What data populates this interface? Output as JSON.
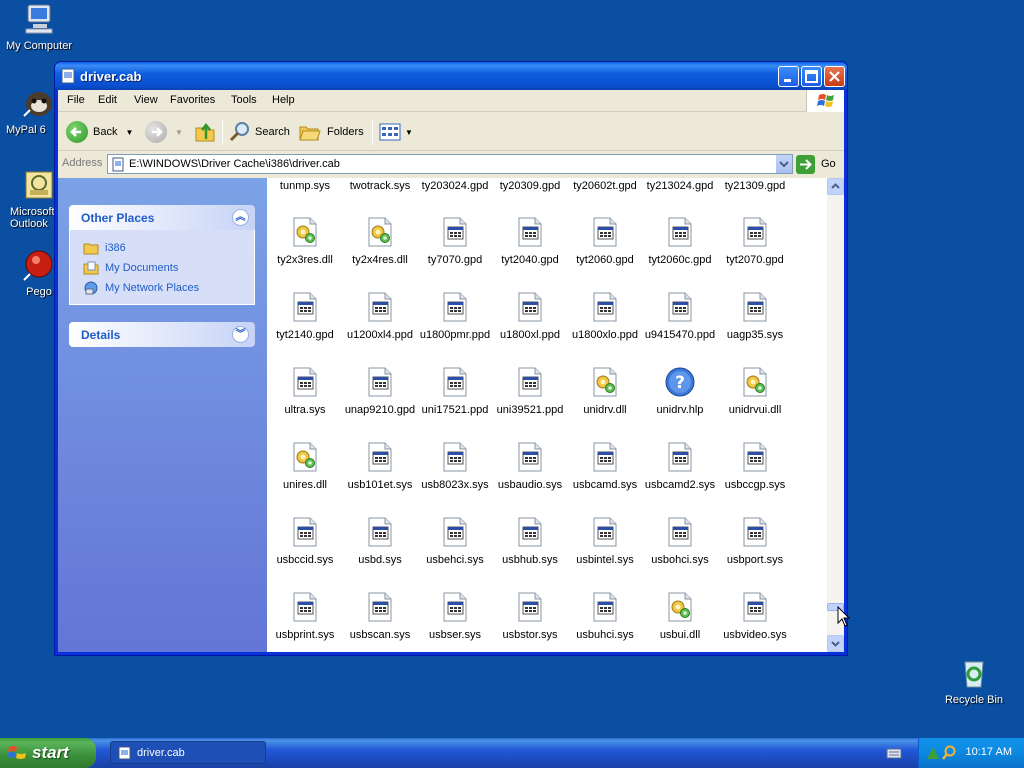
{
  "desktop": {
    "icons": [
      {
        "label": "My Computer",
        "icon": "my-computer-icon"
      },
      {
        "label": "MyPal 6",
        "icon": "mypal-icon"
      },
      {
        "label": "Microsoft Outlook",
        "icon": "outlook-icon"
      },
      {
        "label": "Pego",
        "icon": "pego-icon"
      },
      {
        "label": "Recycle Bin",
        "icon": "recycle-bin-icon"
      }
    ]
  },
  "window": {
    "title": "driver.cab",
    "menu": [
      "File",
      "Edit",
      "View",
      "Favorites",
      "Tools",
      "Help"
    ],
    "toolbar": {
      "back": "Back",
      "search": "Search",
      "folders": "Folders"
    },
    "address": {
      "label": "Address",
      "value": "E:\\WINDOWS\\Driver Cache\\i386\\driver.cab",
      "go": "Go"
    },
    "left_pane": {
      "other_places": {
        "title": "Other Places",
        "items": [
          {
            "label": "i386",
            "icon": "folder-icon"
          },
          {
            "label": "My Documents",
            "icon": "my-documents-icon"
          },
          {
            "label": "My Network Places",
            "icon": "network-places-icon"
          }
        ]
      },
      "details": {
        "title": "Details"
      }
    },
    "files": [
      {
        "name": "tunmp.sys",
        "type": "sys"
      },
      {
        "name": "twotrack.sys",
        "type": "sys"
      },
      {
        "name": "ty203024.gpd",
        "type": "gpd"
      },
      {
        "name": "ty20309.gpd",
        "type": "gpd"
      },
      {
        "name": "ty20602t.gpd",
        "type": "gpd"
      },
      {
        "name": "ty213024.gpd",
        "type": "gpd"
      },
      {
        "name": "ty21309.gpd",
        "type": "gpd"
      },
      {
        "name": "ty2x3res.dll",
        "type": "dll"
      },
      {
        "name": "ty2x4res.dll",
        "type": "dll"
      },
      {
        "name": "ty7070.gpd",
        "type": "gpd"
      },
      {
        "name": "tyt2040.gpd",
        "type": "gpd"
      },
      {
        "name": "tyt2060.gpd",
        "type": "gpd"
      },
      {
        "name": "tyt2060c.gpd",
        "type": "gpd"
      },
      {
        "name": "tyt2070.gpd",
        "type": "gpd"
      },
      {
        "name": "tyt2140.gpd",
        "type": "gpd"
      },
      {
        "name": "u1200xl4.ppd",
        "type": "ppd"
      },
      {
        "name": "u1800pmr.ppd",
        "type": "ppd"
      },
      {
        "name": "u1800xl.ppd",
        "type": "ppd"
      },
      {
        "name": "u1800xlo.ppd",
        "type": "ppd"
      },
      {
        "name": "u9415470.ppd",
        "type": "ppd"
      },
      {
        "name": "uagp35.sys",
        "type": "sys"
      },
      {
        "name": "ultra.sys",
        "type": "sys"
      },
      {
        "name": "unap9210.gpd",
        "type": "gpd"
      },
      {
        "name": "uni17521.ppd",
        "type": "ppd"
      },
      {
        "name": "uni39521.ppd",
        "type": "ppd"
      },
      {
        "name": "unidrv.dll",
        "type": "dll"
      },
      {
        "name": "unidrv.hlp",
        "type": "hlp"
      },
      {
        "name": "unidrvui.dll",
        "type": "dll"
      },
      {
        "name": "unires.dll",
        "type": "dll"
      },
      {
        "name": "usb101et.sys",
        "type": "sys"
      },
      {
        "name": "usb8023x.sys",
        "type": "sys"
      },
      {
        "name": "usbaudio.sys",
        "type": "sys"
      },
      {
        "name": "usbcamd.sys",
        "type": "sys"
      },
      {
        "name": "usbcamd2.sys",
        "type": "sys"
      },
      {
        "name": "usbccgp.sys",
        "type": "sys"
      },
      {
        "name": "usbccid.sys",
        "type": "sys"
      },
      {
        "name": "usbd.sys",
        "type": "sys"
      },
      {
        "name": "usbehci.sys",
        "type": "sys"
      },
      {
        "name": "usbhub.sys",
        "type": "sys"
      },
      {
        "name": "usbintel.sys",
        "type": "sys"
      },
      {
        "name": "usbohci.sys",
        "type": "sys"
      },
      {
        "name": "usbport.sys",
        "type": "sys"
      },
      {
        "name": "usbprint.sys",
        "type": "sys"
      },
      {
        "name": "usbscan.sys",
        "type": "sys"
      },
      {
        "name": "usbser.sys",
        "type": "sys"
      },
      {
        "name": "usbstor.sys",
        "type": "sys"
      },
      {
        "name": "usbuhci.sys",
        "type": "sys"
      },
      {
        "name": "usbui.dll",
        "type": "dll"
      },
      {
        "name": "usbvideo.sys",
        "type": "sys"
      }
    ]
  },
  "taskbar": {
    "start": "start",
    "task_title": "driver.cab",
    "clock": "10:17 AM"
  },
  "colors": {
    "desktop": "#0b4fa3",
    "titlebar": "#0a4fd0",
    "task_link": "#215dc6",
    "start_green": "#3a8e3a"
  }
}
